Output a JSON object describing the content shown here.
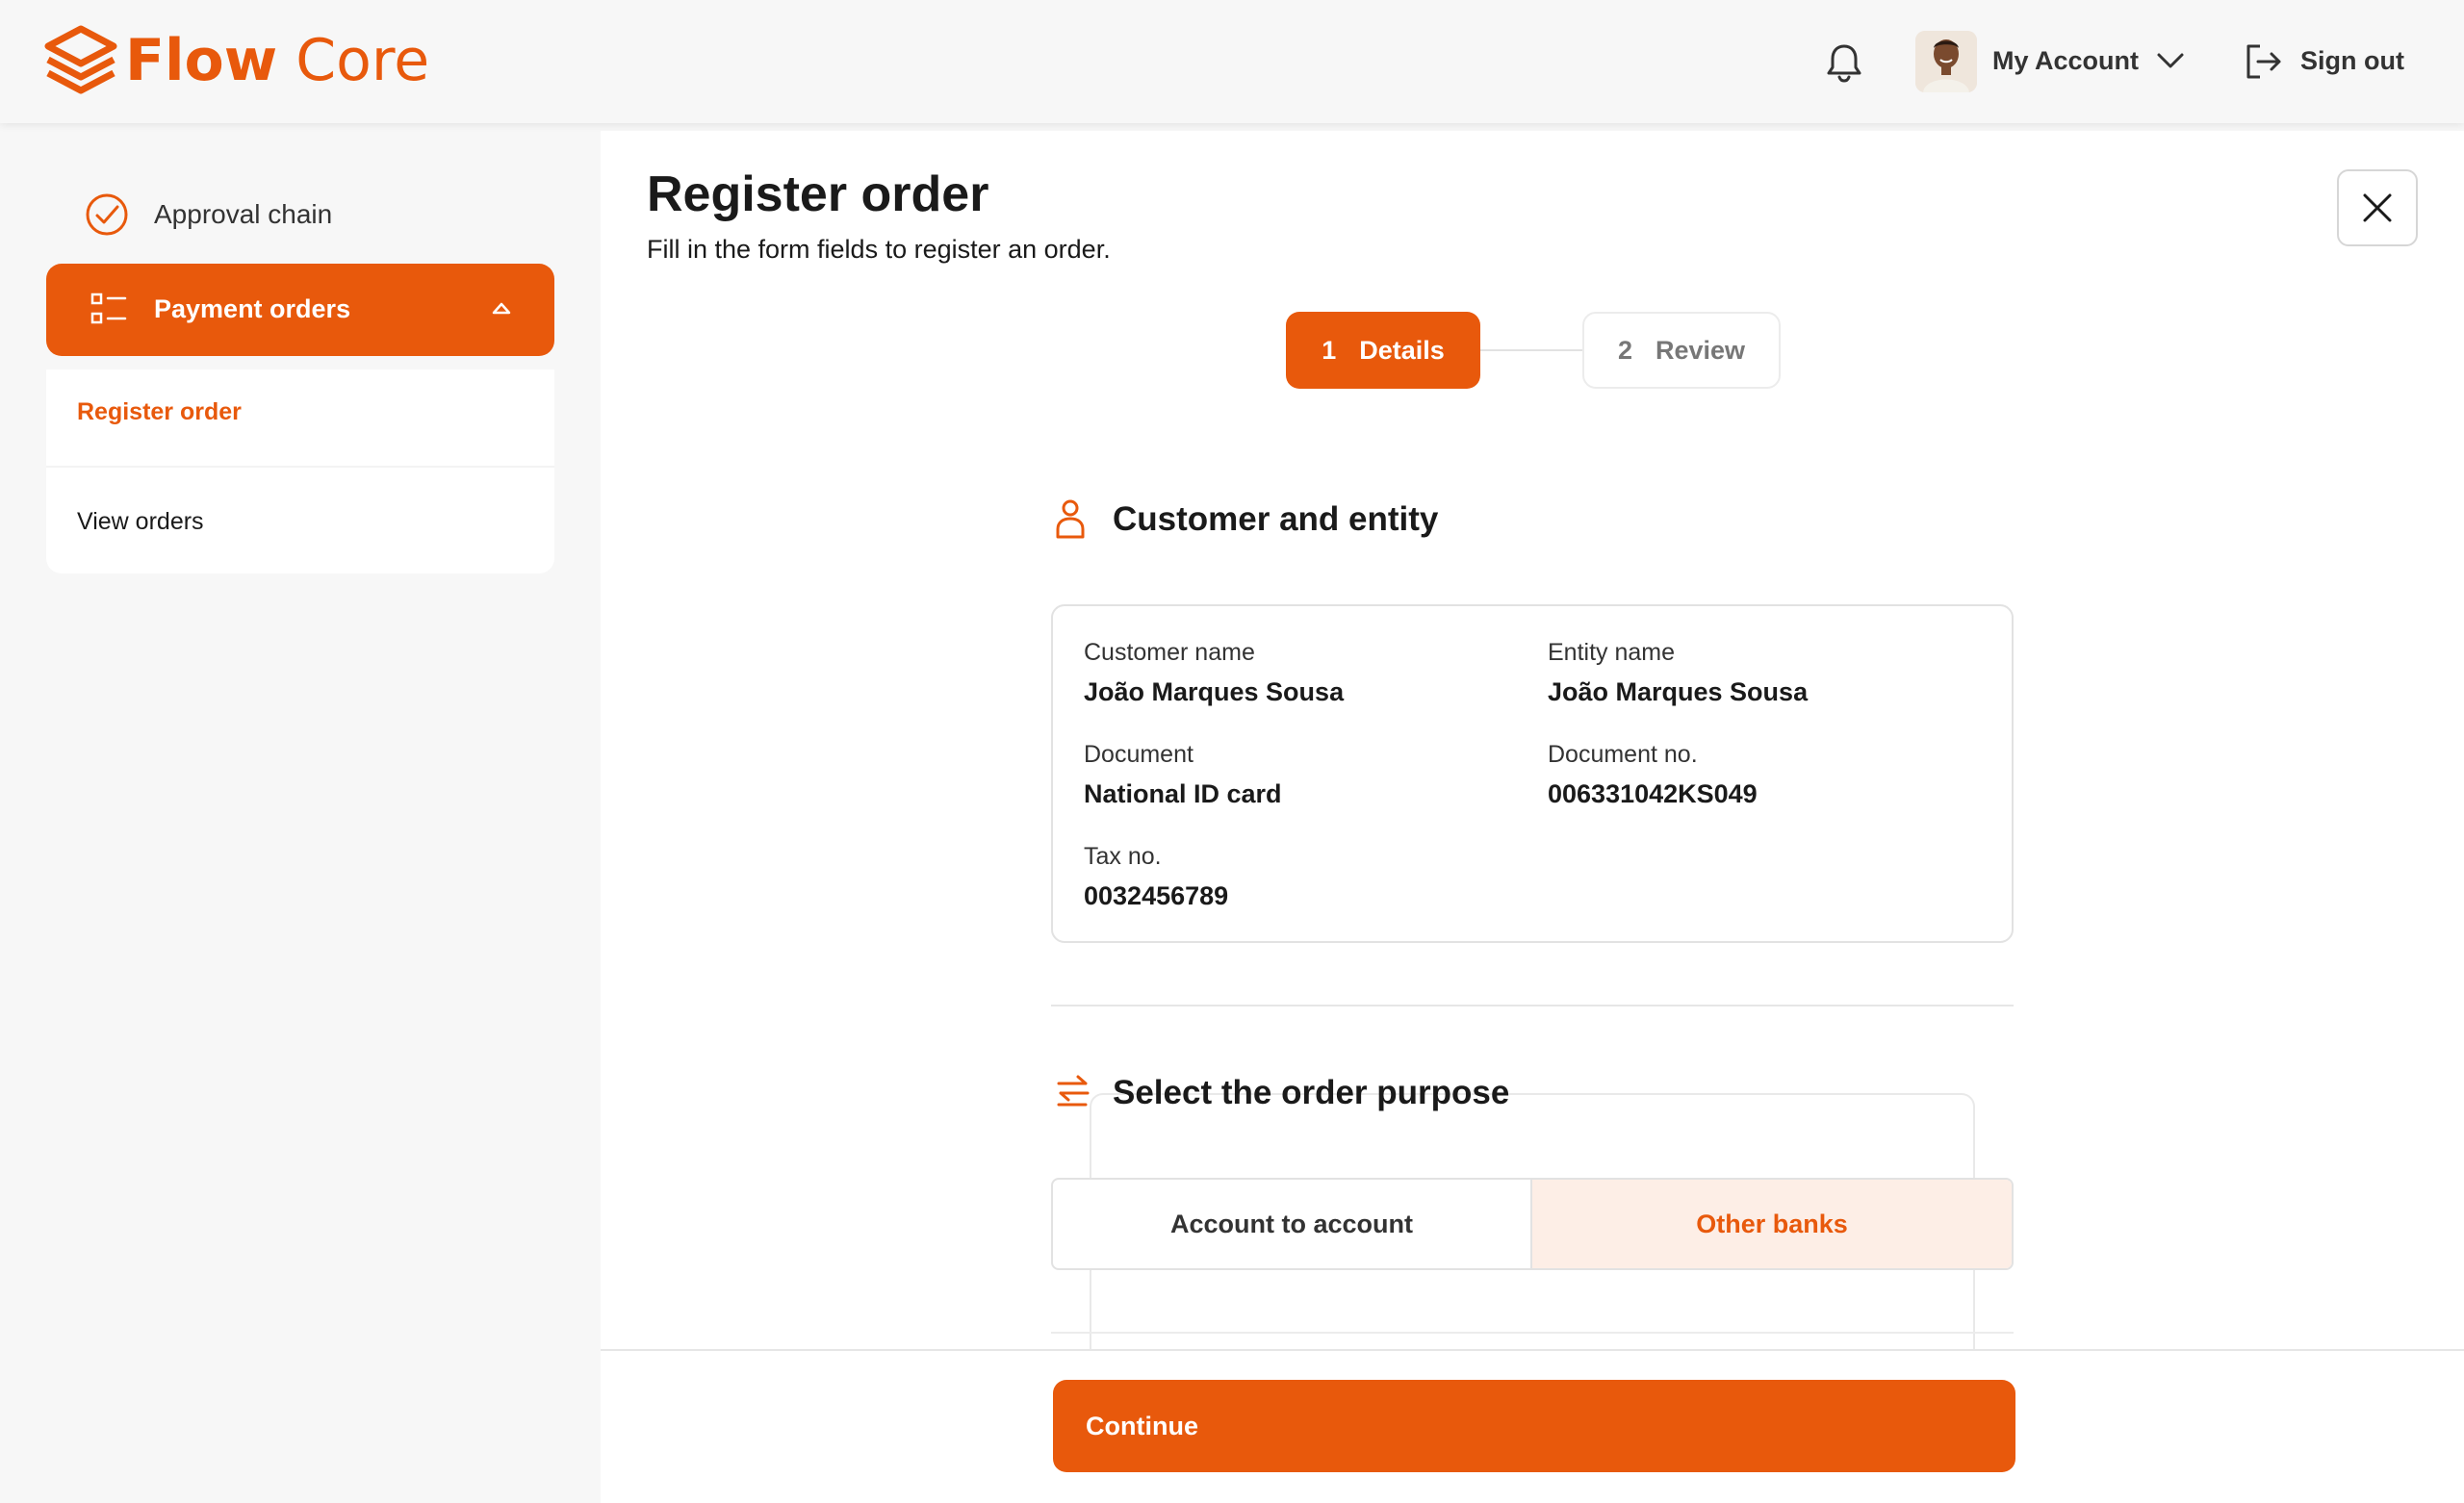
{
  "brand": {
    "name_bold": "Flow",
    "name_light": "Core",
    "accent": "#e8590c"
  },
  "header": {
    "notifications_icon": "bell-icon",
    "account_label": "My Account",
    "signout_label": "Sign out"
  },
  "sidebar": {
    "approval_label": "Approval chain",
    "payment_orders_label": "Payment orders",
    "submenu": [
      {
        "label": "Register order",
        "active": true
      },
      {
        "label": "View orders",
        "active": false
      }
    ]
  },
  "page": {
    "title": "Register order",
    "subtitle": "Fill in the form fields to register an order."
  },
  "stepper": [
    {
      "number": "1",
      "label": "Details",
      "active": true
    },
    {
      "number": "2",
      "label": "Review",
      "active": false
    }
  ],
  "customer_section": {
    "title": "Customer and entity",
    "fields": {
      "customer_name": {
        "label": "Customer name",
        "value": "João Marques Sousa"
      },
      "entity_name": {
        "label": "Entity name",
        "value": "João Marques Sousa"
      },
      "document": {
        "label": "Document",
        "value": "National ID card"
      },
      "document_no": {
        "label": "Document no.",
        "value": "006331042KS049"
      },
      "tax_no": {
        "label": "Tax no.",
        "value": "0032456789"
      }
    }
  },
  "purpose_section": {
    "title": "Select the order purpose",
    "options": [
      {
        "label": "Account to account",
        "selected": false
      },
      {
        "label": "Other banks",
        "selected": true
      }
    ]
  },
  "footer": {
    "continue_label": "Continue"
  }
}
